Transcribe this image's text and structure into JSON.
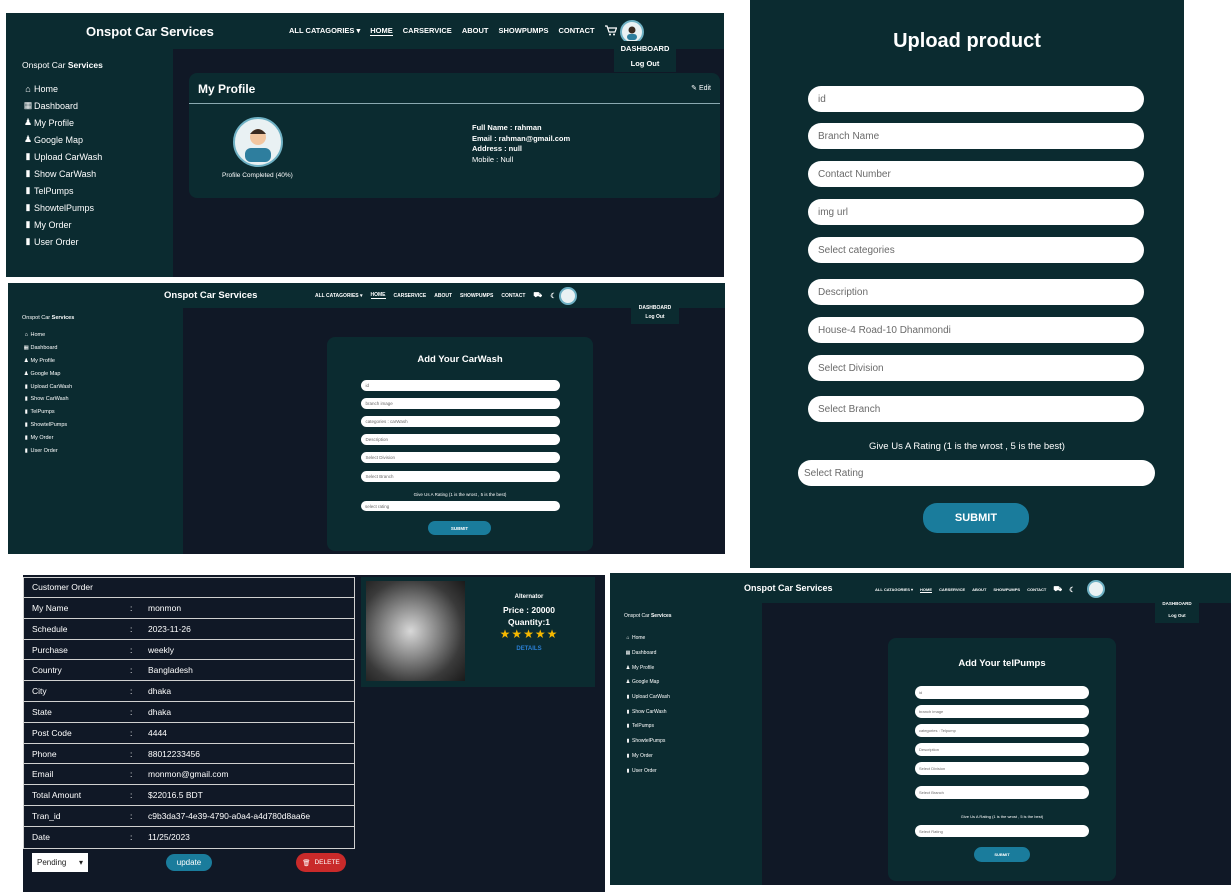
{
  "nav": {
    "brand": "Onspot Car Services",
    "links": [
      "ALL CATAGORIES ▾",
      "HOME",
      "CARSERVICE",
      "ABOUT",
      "SHOWPUMPS",
      "CONTACT"
    ],
    "dropdown": [
      "DASHBOARD",
      "Log Out"
    ]
  },
  "sidebar": {
    "title_prefix": "Onspot Car ",
    "title_bold": "Services",
    "items": [
      "Home",
      "Dashboard",
      "My Profile",
      "Google Map",
      "Upload CarWash",
      "Show CarWash",
      "TelPumps",
      "ShowtelPumps",
      "My Order",
      "User Order"
    ]
  },
  "profile": {
    "title": "My Profile",
    "edit": "Edit",
    "completed": "Profile Completed (40%)",
    "lines": [
      "Full Name : rahman",
      "Email : rahman@gmail.com",
      "Address : null",
      "Mobile : Null"
    ]
  },
  "upload": {
    "title": "Upload product",
    "fields": [
      "id",
      "Branch Name",
      "Contact Number",
      "img url",
      "Select categories",
      "Description",
      "House-4 Road-10 Dhanmondi",
      "Select Division",
      "Select Branch"
    ],
    "rating_label": "Give Us A Rating (1 is the wrost , 5 is the best)",
    "rating": "Select Rating",
    "submit": "SUBMIT"
  },
  "carwash": {
    "title": "Add Your CarWash",
    "fields": [
      "id",
      "branch image",
      "categories : carWash",
      "Description",
      "Select Division",
      "Select Branch"
    ],
    "rating_label": "Give Us A Rating (1 is the wrost , 5 is the best)",
    "rating": "select rating",
    "submit": "SUBMIT"
  },
  "telpumps": {
    "title": "Add Your telPumps",
    "fields": [
      "id",
      "branch image",
      "categories : Telpump",
      "Description",
      "Select Division",
      "Select Branch"
    ],
    "rating_label": "Give Us A Rating (1 is the wrost , 5 is the best)",
    "rating": "Select Rating",
    "submit": "SUBMIT"
  },
  "order": {
    "header": "Customer Order",
    "rows": [
      {
        "label": "My Name",
        "value": "monmon"
      },
      {
        "label": "Schedule",
        "value": "2023-11-26"
      },
      {
        "label": "Purchase",
        "value": "weekly"
      },
      {
        "label": "Country",
        "value": "Bangladesh"
      },
      {
        "label": "City",
        "value": "dhaka"
      },
      {
        "label": "State",
        "value": "dhaka"
      },
      {
        "label": "Post Code",
        "value": "4444"
      },
      {
        "label": "Phone",
        "value": "88012233456"
      },
      {
        "label": "Email",
        "value": "monmon@gmail.com"
      },
      {
        "label": "Total Amount",
        "value": "$22016.5 BDT"
      },
      {
        "label": "Tran_id",
        "value": "c9b3da37-4e39-4790-a0a4-a4d780d8aa6e"
      },
      {
        "label": "Date",
        "value": "11/25/2023"
      }
    ],
    "status": "Pending",
    "update": "update",
    "delete": "DELETE",
    "product": {
      "name": "Alternator",
      "price": "Price : 20000",
      "quantity": "Quantity:1",
      "stars": "★★★★★",
      "details": "DETAILS"
    }
  },
  "colors": {
    "nav": "#0b2b30",
    "bg": "#101826",
    "accent": "#1a7c9c",
    "delete": "#c92a2a",
    "star": "#f5b800"
  }
}
